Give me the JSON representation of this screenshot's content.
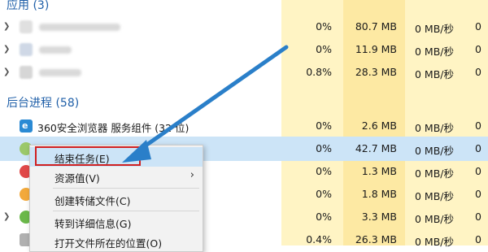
{
  "colors": {
    "accent": "#1f5fa8",
    "highlight_column": "#fff4c4",
    "highlight_column_alt": "#fde9a3",
    "selection_red": "#d02020",
    "arrow_blue": "#2a7fc9"
  },
  "groups": {
    "apps_header": "应用 (3)",
    "background_header": "后台进程 (58)"
  },
  "app_rows": [
    {
      "cpu": "0%",
      "mem": "80.7 MB",
      "disk": "0 MB/秒",
      "net": "0"
    },
    {
      "cpu": "0%",
      "mem": "11.9 MB",
      "disk": "0 MB/秒",
      "net": "0"
    },
    {
      "cpu": "0.8%",
      "mem": "28.3 MB",
      "disk": "0 MB/秒",
      "net": "0"
    }
  ],
  "bg_rows": [
    {
      "name": "360安全浏览器 服务组件 (32 位)",
      "cpu": "0%",
      "mem": "2.6 MB",
      "disk": "0 MB/秒",
      "net": "0"
    },
    {
      "name": "",
      "cpu": "0%",
      "mem": "42.7 MB",
      "disk": "0 MB/秒",
      "net": "0"
    },
    {
      "name": "",
      "cpu": "0%",
      "mem": "1.3 MB",
      "disk": "0 MB/秒",
      "net": "0"
    },
    {
      "name": "",
      "cpu": "0%",
      "mem": "1.8 MB",
      "disk": "0 MB/秒",
      "net": "0"
    },
    {
      "name": "",
      "cpu": "0%",
      "mem": "3.3 MB",
      "disk": "0 MB/秒",
      "net": "0"
    },
    {
      "name": "",
      "cpu": "0.4%",
      "mem": "26.3 MB",
      "disk": "0 MB/秒",
      "net": "0"
    }
  ],
  "context_menu": {
    "end_task": "结束任务(E)",
    "resource_values": "资源值(V)",
    "create_dump": "创建转储文件(C)",
    "go_to_details": "转到详细信息(G)",
    "open_file_location": "打开文件所在的位置(O)"
  },
  "icons": {
    "chevron": "chevron-right-icon",
    "submenu": "chevron-right-icon",
    "browser_service": "browser-service-icon"
  }
}
